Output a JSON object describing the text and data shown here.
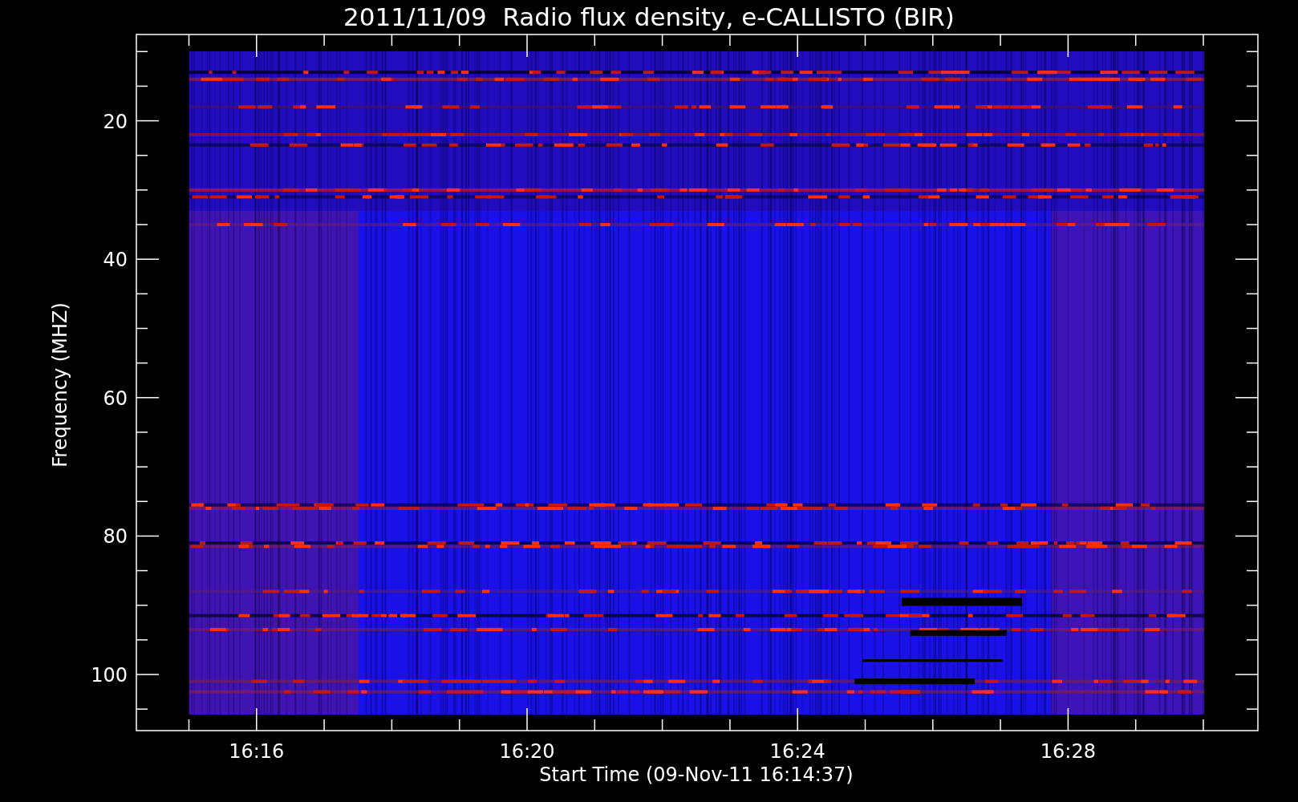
{
  "title": "2011/11/09  Radio flux density, e-CALLISTO (BIR)",
  "y_axis": {
    "label": "Frequency (MHZ)",
    "ticks": [
      "20",
      "40",
      "60",
      "80",
      "100"
    ]
  },
  "x_axis": {
    "label": "Start Time (09-Nov-11 16:14:37)",
    "ticks": [
      "16:16",
      "16:20",
      "16:24",
      "16:28"
    ]
  }
}
